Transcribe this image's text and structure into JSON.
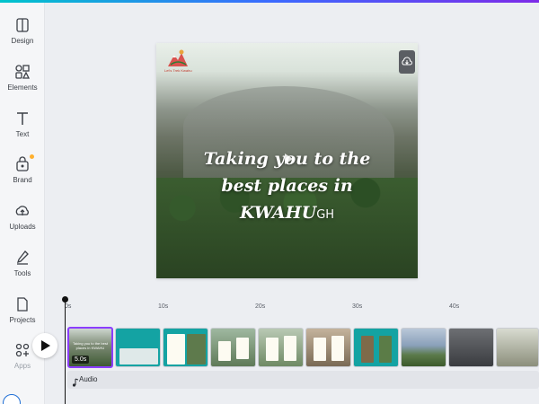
{
  "sidebar": {
    "items": [
      {
        "label": "Design",
        "icon": "design-icon"
      },
      {
        "label": "Elements",
        "icon": "elements-icon"
      },
      {
        "label": "Text",
        "icon": "text-icon"
      },
      {
        "label": "Brand",
        "icon": "brand-icon"
      },
      {
        "label": "Uploads",
        "icon": "uploads-icon"
      },
      {
        "label": "Tools",
        "icon": "tools-icon"
      },
      {
        "label": "Projects",
        "icon": "projects-icon"
      },
      {
        "label": "Apps",
        "icon": "apps-icon"
      }
    ]
  },
  "canvas": {
    "logo_caption": "Let's Trek Kwahu",
    "headline_line1": "Taking you to the",
    "headline_line2": "best places in",
    "headline_line3": "KWAHU",
    "headline_suffix": "GH"
  },
  "timeline": {
    "ruler_labels": [
      "0s",
      "10s",
      "20s",
      "30s",
      "40s"
    ],
    "first_clip_duration": "5.0s",
    "audio_label": "Audio"
  },
  "colors": {
    "accent": "#8b3dff",
    "teal": "#14a3a3"
  }
}
